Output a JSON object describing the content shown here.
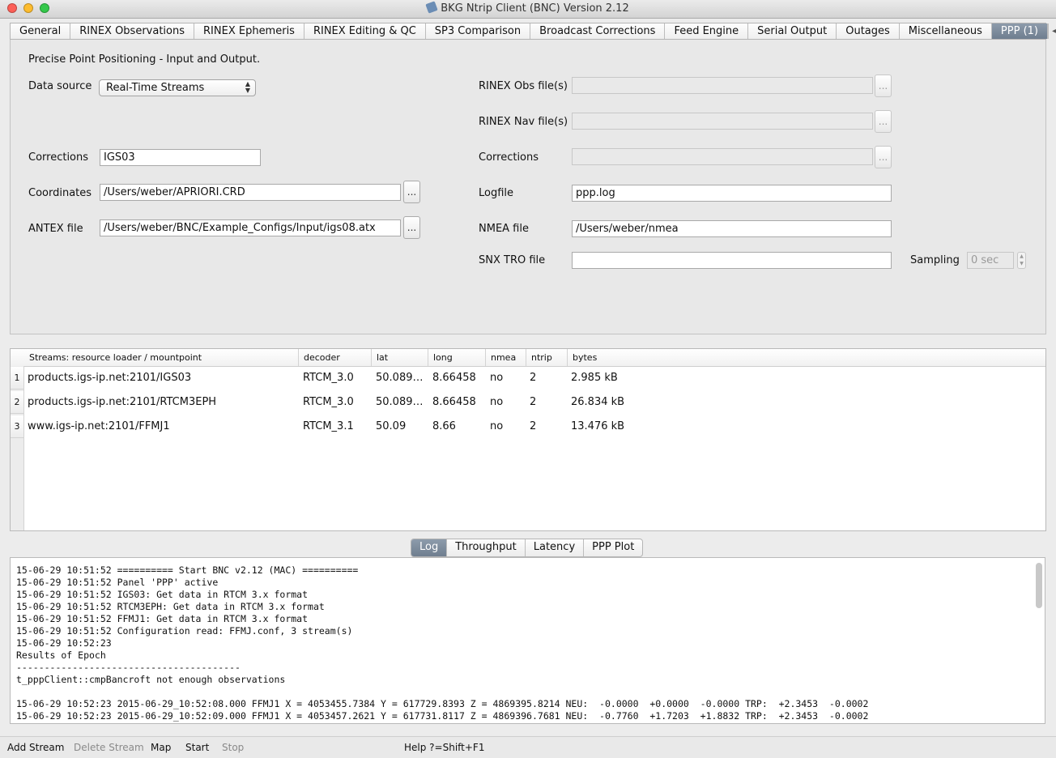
{
  "window": {
    "title": "BKG Ntrip Client (BNC) Version 2.12"
  },
  "tabs": [
    {
      "label": "General"
    },
    {
      "label": "RINEX Observations"
    },
    {
      "label": "RINEX Ephemeris"
    },
    {
      "label": "RINEX Editing & QC"
    },
    {
      "label": "SP3 Comparison"
    },
    {
      "label": "Broadcast Corrections"
    },
    {
      "label": "Feed Engine"
    },
    {
      "label": "Serial Output"
    },
    {
      "label": "Outages"
    },
    {
      "label": "Miscellaneous"
    },
    {
      "label": "PPP (1)"
    }
  ],
  "ppp": {
    "heading": "Precise Point Positioning - Input and Output.",
    "data_source_label": "Data source",
    "data_source_value": "Real-Time Streams",
    "corrections_label": "Corrections",
    "corrections_value": "IGS03",
    "coordinates_label": "Coordinates",
    "coordinates_value": "/Users/weber/APRIORI.CRD",
    "antex_label": "ANTEX file",
    "antex_value": "/Users/weber/BNC/Example_Configs/Input/igs08.atx",
    "rinex_obs_label": "RINEX Obs file(s)",
    "rinex_nav_label": "RINEX Nav file(s)",
    "corrections2_label": "Corrections",
    "logfile_label": "Logfile",
    "logfile_value": "ppp.log",
    "nmea_label": "NMEA file",
    "nmea_value": "/Users/weber/nmea",
    "snx_label": "SNX TRO file",
    "snx_value": "",
    "sampling_label": "Sampling",
    "sampling_value": "0 sec",
    "browse_label": "..."
  },
  "streams": {
    "headers": {
      "mountpoint": "Streams:   resource loader / mountpoint",
      "decoder": "decoder",
      "lat": "lat",
      "long": "long",
      "nmea": "nmea",
      "ntrip": "ntrip",
      "bytes": "bytes"
    },
    "rows": [
      {
        "num": "1",
        "mountpoint": "products.igs-ip.net:2101/IGS03",
        "decoder": "RTCM_3.0",
        "lat": "50.089…",
        "long": "8.66458",
        "nmea": "no",
        "ntrip": "2",
        "bytes": "2.985 kB"
      },
      {
        "num": "2",
        "mountpoint": "products.igs-ip.net:2101/RTCM3EPH",
        "decoder": "RTCM_3.0",
        "lat": "50.089…",
        "long": "8.66458",
        "nmea": "no",
        "ntrip": "2",
        "bytes": "26.834 kB"
      },
      {
        "num": "3",
        "mountpoint": "www.igs-ip.net:2101/FFMJ1",
        "decoder": "RTCM_3.1",
        "lat": "50.09",
        "long": "8.66",
        "nmea": "no",
        "ntrip": "2",
        "bytes": "13.476 kB"
      }
    ]
  },
  "lower_tabs": [
    {
      "label": "Log"
    },
    {
      "label": "Throughput"
    },
    {
      "label": "Latency"
    },
    {
      "label": "PPP Plot"
    }
  ],
  "log": [
    "15-06-29 10:51:52 ========== Start BNC v2.12 (MAC) ==========",
    "15-06-29 10:51:52 Panel 'PPP' active",
    "15-06-29 10:51:52 IGS03: Get data in RTCM 3.x format",
    "15-06-29 10:51:52 RTCM3EPH: Get data in RTCM 3.x format",
    "15-06-29 10:51:52 FFMJ1: Get data in RTCM 3.x format",
    "15-06-29 10:51:52 Configuration read: FFMJ.conf, 3 stream(s)",
    "15-06-29 10:52:23",
    "Results of Epoch",
    "----------------------------------------",
    "t_pppClient::cmpBancroft not enough observations",
    "",
    "15-06-29 10:52:23 2015-06-29_10:52:08.000 FFMJ1 X = 4053455.7384 Y = 617729.8393 Z = 4869395.8214 NEU:  -0.0000  +0.0000  -0.0000 TRP:  +2.3453  -0.0002",
    "15-06-29 10:52:23 2015-06-29_10:52:09.000 FFMJ1 X = 4053457.2621 Y = 617731.8117 Z = 4869396.7681 NEU:  -0.7760  +1.7203  +1.8832 TRP:  +2.3453  -0.0002"
  ],
  "bottom": {
    "add_stream": "Add Stream",
    "delete_stream": "Delete Stream",
    "map": "Map",
    "start": "Start",
    "stop": "Stop",
    "help": "Help ?=Shift+F1"
  }
}
